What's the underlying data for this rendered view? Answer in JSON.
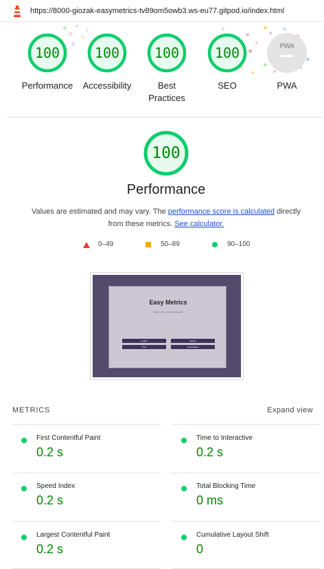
{
  "browser": {
    "url": "https://8000-giozak-easymetrics-tv89om5owb3.ws-eu77.gitpod.io/index.html"
  },
  "gauges": [
    {
      "label": "Performance",
      "score": "100"
    },
    {
      "label": "Accessibility",
      "score": "100"
    },
    {
      "label": "Best",
      "label2": "Practices",
      "score": "100"
    },
    {
      "label": "SEO",
      "score": "100"
    },
    {
      "label": "PWA",
      "badge": "PWA"
    }
  ],
  "performance": {
    "score": "100",
    "title": "Performance",
    "desc_part1": "Values are estimated and may vary. The ",
    "desc_link1": "performance score is calculated",
    "desc_part2": " directly from these metrics. ",
    "desc_link2": "See calculator."
  },
  "legend": {
    "fail": "0–49",
    "average": "50–89",
    "pass": "90–100"
  },
  "screenshot": {
    "title": "Easy Metrics",
    "subtitle": "Click on the conversion needed",
    "buttons": [
      "Length",
      "Weight",
      "Time",
      "Temperature"
    ]
  },
  "metrics": {
    "heading": "METRICS",
    "expand_label": "Expand view",
    "items": [
      {
        "label": "First Contentful Paint",
        "value": "0.2 s"
      },
      {
        "label": "Time to Interactive",
        "value": "0.2 s"
      },
      {
        "label": "Speed Index",
        "value": "0.2 s"
      },
      {
        "label": "Total Blocking Time",
        "value": "0 ms"
      },
      {
        "label": "Largest Contentful Paint",
        "value": "0.2 s"
      },
      {
        "label": "Cumulative Layout Shift",
        "value": "0"
      }
    ]
  },
  "colors": {
    "pass": "#0cce6b",
    "pass_text": "#008800",
    "average": "#f5a623",
    "fail": "#e63b32",
    "link": "#1a4ed8"
  },
  "icons": {
    "logo": "lighthouse-icon",
    "fail": "triangle-icon",
    "average": "square-icon",
    "pass": "circle-icon"
  }
}
